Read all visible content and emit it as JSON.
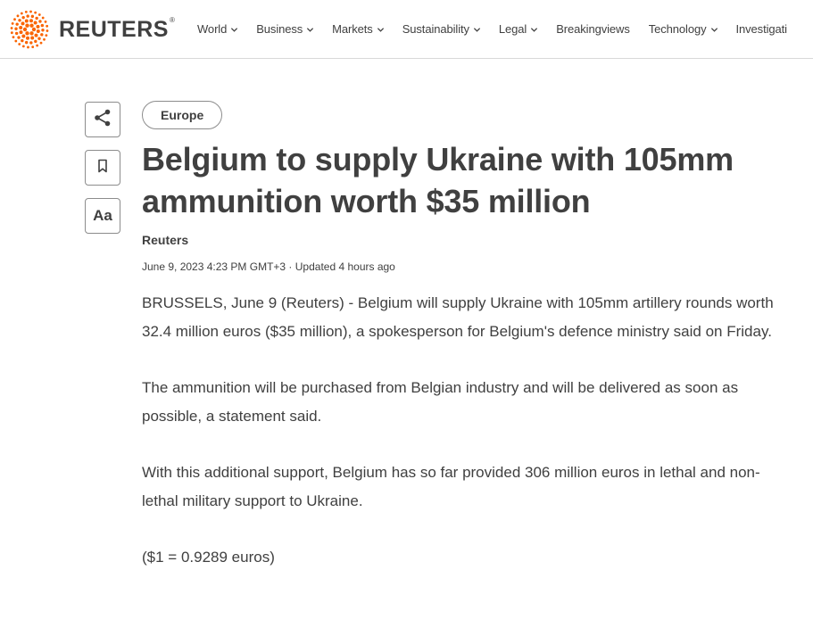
{
  "header": {
    "logo_text": "REUTERS",
    "logo_mark": "®",
    "nav": [
      {
        "label": "World",
        "has_dropdown": true
      },
      {
        "label": "Business",
        "has_dropdown": true
      },
      {
        "label": "Markets",
        "has_dropdown": true
      },
      {
        "label": "Sustainability",
        "has_dropdown": true
      },
      {
        "label": "Legal",
        "has_dropdown": true
      },
      {
        "label": "Breakingviews",
        "has_dropdown": false
      },
      {
        "label": "Technology",
        "has_dropdown": true
      },
      {
        "label": "Investigati",
        "has_dropdown": false
      }
    ]
  },
  "tools": {
    "share_icon": "share-icon",
    "bookmark_icon": "bookmark-icon",
    "font_label": "Aa"
  },
  "article": {
    "tag": "Europe",
    "headline_line1": "Belgium to supply Ukraine with 105mm",
    "headline_line2": "ammunition worth $35 million",
    "author": "Reuters",
    "dateline": "June 9, 2023 4:23 PM GMT+3 · Updated 4 hours ago",
    "paragraphs": [
      "BRUSSELS, June 9 (Reuters) - Belgium will supply Ukraine with 105mm artillery rounds worth 32.4 million euros ($35 million), a spokesperson for Belgium's defence ministry said on Friday.",
      "The ammunition will be purchased from Belgian industry and will be delivered as soon as possible, a statement said.",
      "With this additional support, Belgium has so far provided 306 million euros in lethal and non-lethal military support to Ukraine.",
      "($1 = 0.9289 euros)"
    ]
  },
  "colors": {
    "text": "#404040",
    "logo_orange": "#fa6400",
    "border": "#8c8c8c"
  }
}
